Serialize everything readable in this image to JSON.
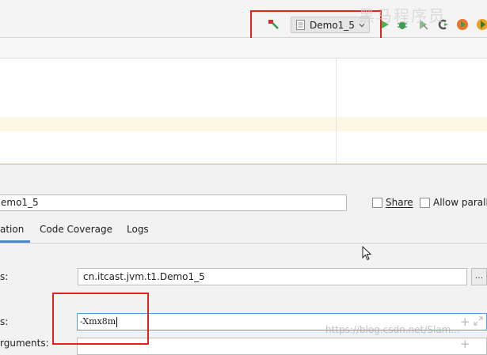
{
  "toolbar": {
    "run_config": "Demo1_5",
    "icons": [
      "hammer-build-icon",
      "run-icon",
      "debug-icon",
      "coverage-icon",
      "profile-icon",
      "record-icon"
    ]
  },
  "dialog": {
    "name_value": "emo1_5",
    "share_label": "Share",
    "allow_parallel_label": "Allow paralle",
    "tabs": [
      {
        "label": "ation"
      },
      {
        "label": "Code Coverage"
      },
      {
        "label": "Logs"
      }
    ],
    "main_class_label": "s:",
    "main_class_value": "cn.itcast.jvm.t1.Demo1_5",
    "browse_label": "...",
    "vm_options_label": "s:",
    "vm_options_value": "-Xmx8m",
    "args_label": "rguments:",
    "plus": "+"
  },
  "watermarks": {
    "top": "黑马程序员",
    "bottom": "https://blog.csdn.net/Slam..."
  },
  "colors": {
    "annotation_red": "#e0241c",
    "accent_blue": "#4a87c7",
    "run_green": "#4caf50",
    "current_line": "#fcf7e4"
  }
}
